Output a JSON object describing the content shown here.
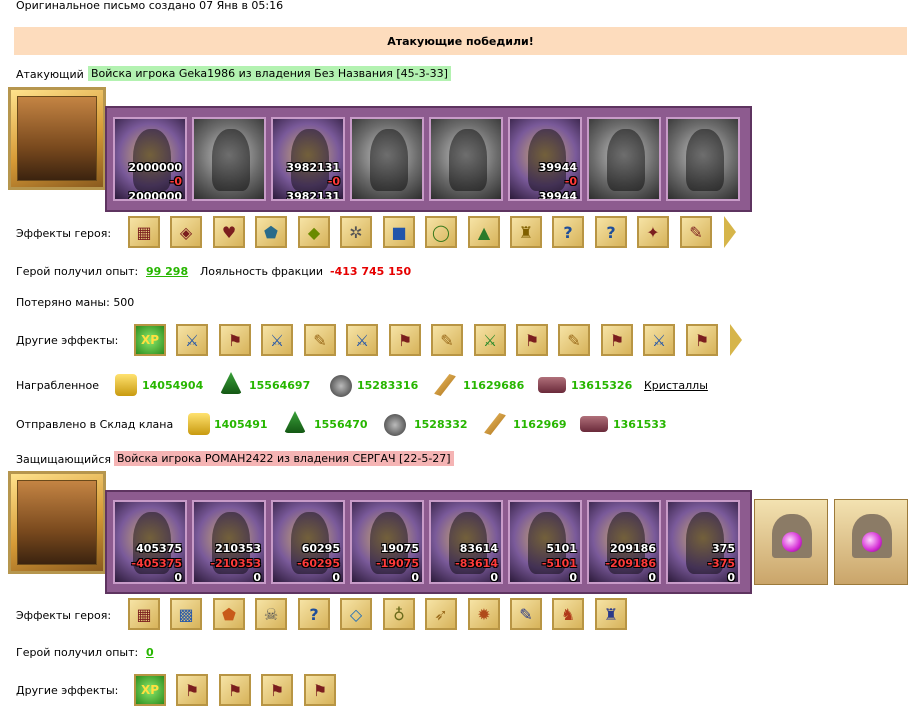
{
  "header_note": "Оригинальное письмо создано 07 Янв в 05:16",
  "result_banner": "Атакующие победили!",
  "attacker": {
    "label": "Атакующий",
    "army": "Войска игрока Geka1986 из владения Без Названия [45-3-33]",
    "units": [
      {
        "icon": "purple-demon-unit",
        "count": "2000000",
        "lost": "-0",
        "remain": "2000000"
      },
      {
        "icon": "dark-knight-unit",
        "count": "",
        "lost": "",
        "remain": ""
      },
      {
        "icon": "dragon-rider-unit",
        "count": "3982131",
        "lost": "-0",
        "remain": "3982131"
      },
      {
        "icon": "griffin-unit",
        "count": "",
        "lost": "",
        "remain": ""
      },
      {
        "icon": "archer-unit",
        "count": "",
        "lost": "",
        "remain": ""
      },
      {
        "icon": "sorcerer-unit",
        "count": "39944",
        "lost": "-0",
        "remain": "39944"
      },
      {
        "icon": "reaper-unit",
        "count": "",
        "lost": "",
        "remain": ""
      },
      {
        "icon": "spider-unit",
        "count": "",
        "lost": "",
        "remain": ""
      }
    ],
    "hero_effects_label": "Эффекты героя:",
    "hero_effects": [
      "chest-icon",
      "treasure-icon",
      "heart-icon",
      "shield-icon",
      "gold-icon",
      "gear-icon",
      "cube-icon",
      "ring-icon",
      "amulet-icon",
      "armor-icon",
      "question-icon",
      "question-icon",
      "compass-icon",
      "scroll-icon"
    ],
    "exp_label": "Герой получил опыт:",
    "exp_value": "99 298",
    "loyalty_label": "Лояльность фракции",
    "loyalty_value": "-413 745 150",
    "mana_text": "Потеряно маны: 500",
    "other_effects_label": "Другие эффекты:",
    "other_effects": [
      "xp-icon",
      "sword-icon",
      "flag-icon",
      "sword-icon",
      "scroll-icon",
      "sword-icon",
      "flag-icon",
      "scroll-icon",
      "sword-icon",
      "flag-icon",
      "scroll-icon",
      "flag-icon",
      "sword-icon",
      "flag-icon"
    ],
    "loot_label": "Награбленное",
    "loot": [
      {
        "icon": "gold-coins-icon",
        "value": "14054904"
      },
      {
        "icon": "wood-icon",
        "value": "15564697"
      },
      {
        "icon": "ore-icon",
        "value": "15283316"
      },
      {
        "icon": "wheat-icon",
        "value": "11629686"
      },
      {
        "icon": "stone-icon",
        "value": "13615326"
      }
    ],
    "crystals_link": "Кристаллы",
    "clan_label": "Отправлено в Склад клана",
    "clan": [
      {
        "icon": "gold-coins-icon",
        "value": "1405491"
      },
      {
        "icon": "wood-icon",
        "value": "1556470"
      },
      {
        "icon": "ore-icon",
        "value": "1528332"
      },
      {
        "icon": "wheat-icon",
        "value": "1162969"
      },
      {
        "icon": "stone-icon",
        "value": "1361533"
      }
    ]
  },
  "defender": {
    "label": "Защищающийся",
    "army": "Войска игрока POMAH2422 из владения СЕРГАЧ [22-5-27]",
    "units": [
      {
        "count": "405375",
        "lost": "-405375",
        "remain": "0"
      },
      {
        "count": "210353",
        "lost": "-210353",
        "remain": "0"
      },
      {
        "count": "60295",
        "lost": "-60295",
        "remain": "0"
      },
      {
        "count": "19075",
        "lost": "-19075",
        "remain": "0"
      },
      {
        "count": "83614",
        "lost": "-83614",
        "remain": "0"
      },
      {
        "count": "5101",
        "lost": "-5101",
        "remain": "0"
      },
      {
        "count": "209186",
        "lost": "-209186",
        "remain": "0"
      },
      {
        "count": "375",
        "lost": "-375",
        "remain": "0"
      }
    ],
    "hero_effects_label": "Эффекты героя:",
    "hero_effects": [
      "castle-icon",
      "map-icon",
      "shield-icon",
      "skull-icon",
      "question-icon",
      "crystal-icon",
      "potion-icon",
      "bow-icon",
      "beetle-icon",
      "scroll-icon",
      "cloak-icon",
      "armor-icon"
    ],
    "exp_label": "Герой получил опыт:",
    "exp_value": "0",
    "other_effects_label": "Другие эффекты:",
    "other_effects": [
      "xp-icon",
      "flag-icon",
      "flag-icon",
      "flag-icon",
      "flag-icon"
    ]
  }
}
